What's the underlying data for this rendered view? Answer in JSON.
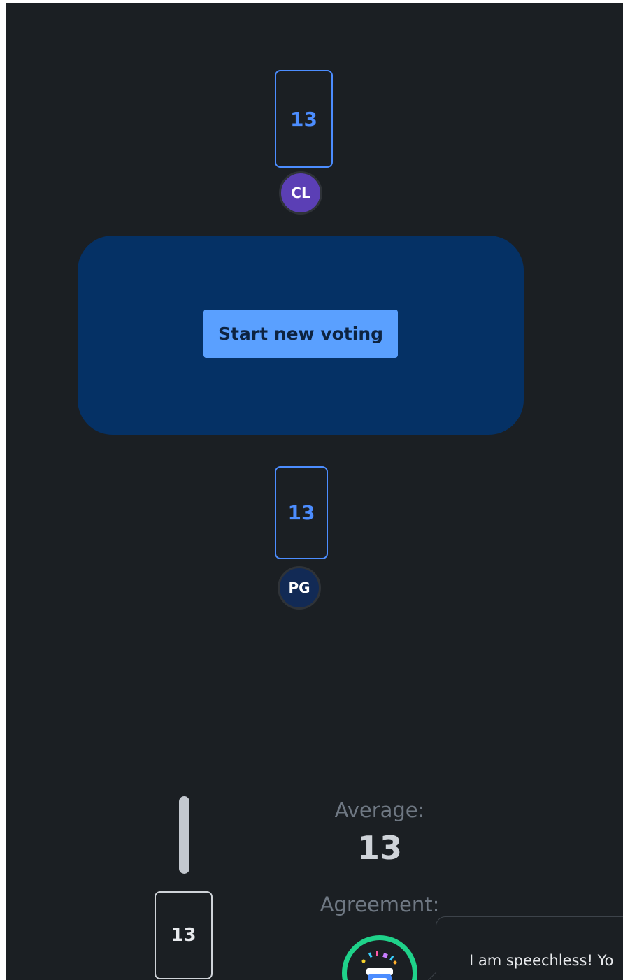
{
  "players": [
    {
      "initials": "CL",
      "card_value": "13",
      "avatar_color": "#5b3fb5"
    },
    {
      "initials": "PG",
      "card_value": "13",
      "avatar_color": "#122a55"
    }
  ],
  "table": {
    "start_button_label": "Start new voting"
  },
  "my_card": {
    "value": "13"
  },
  "results": {
    "average_label": "Average:",
    "average_value": "13",
    "agreement_label": "Agreement:",
    "agreement_icon": "party-robot-icon",
    "agreement_color": "#1fd28a"
  },
  "feedback": {
    "message": "I am speechless! Yo"
  },
  "colors": {
    "background": "#1b1f23",
    "table": "#053165",
    "accent": "#4c8dff",
    "button": "#5aa0ff"
  }
}
